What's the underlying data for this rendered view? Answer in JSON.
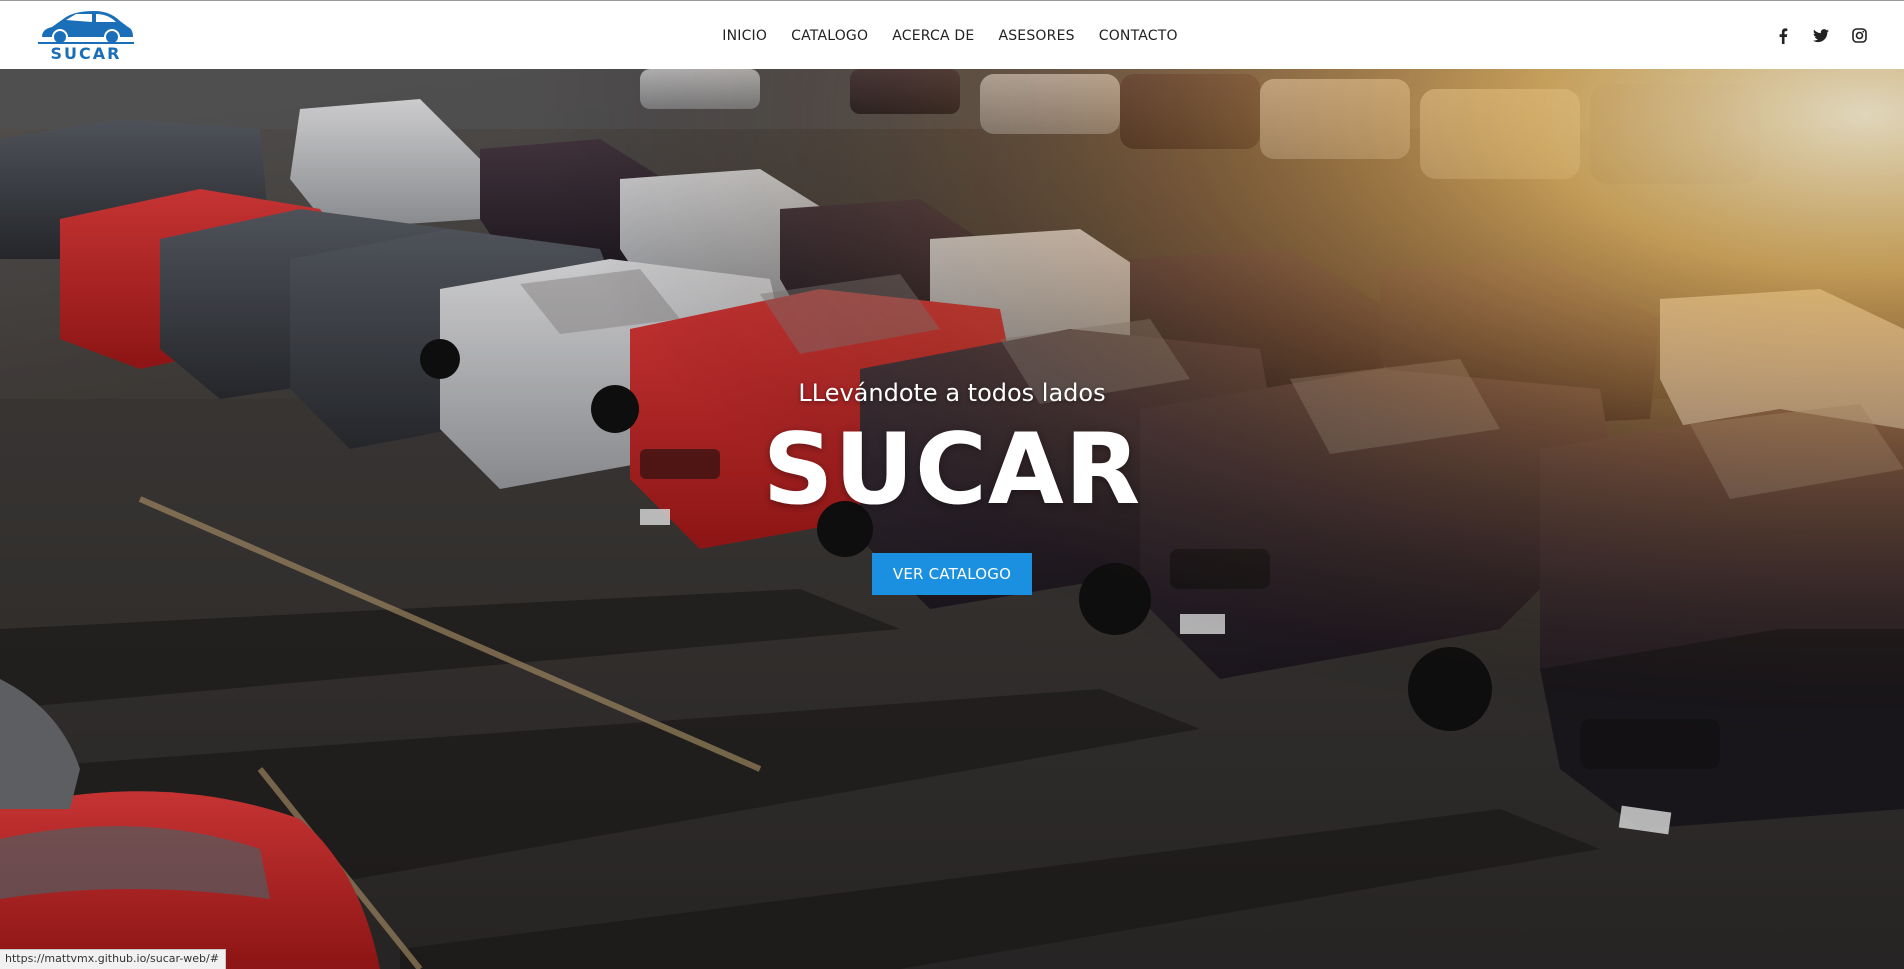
{
  "header": {
    "logo_text": "SUCAR",
    "nav": [
      {
        "label": "INICIO"
      },
      {
        "label": "CATALOGO"
      },
      {
        "label": "ACERCA DE"
      },
      {
        "label": "ASESORES"
      },
      {
        "label": "CONTACTO"
      }
    ],
    "social_icons": [
      "facebook-icon",
      "twitter-icon",
      "instagram-icon"
    ]
  },
  "hero": {
    "tagline": "LLevándote a todos lados",
    "title": "SUCAR",
    "cta_label": "VER CATALOGO",
    "background": "parked cars in a lot at sunset"
  },
  "status_bar": {
    "url": "https://mattvmx.github.io/sucar-web/#"
  },
  "colors": {
    "brand_blue": "#1a6fb8",
    "cta_blue": "#1b8fe0",
    "nav_text": "#222222",
    "header_bg": "#ffffff"
  }
}
